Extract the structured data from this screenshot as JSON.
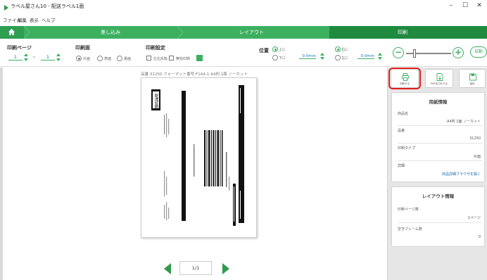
{
  "window": {
    "title": "ラベル屋さん10 - 配送ラベル1面",
    "minimize_glyph": "–",
    "maximize_glyph": "☐",
    "close_glyph": "✕"
  },
  "menu": [
    "ファイル",
    "編集",
    "表示",
    "ヘルプ"
  ],
  "steps": {
    "step1": "差し込み",
    "step2": "レイアウト",
    "step3": "印刷"
  },
  "toolbar": {
    "print_pages": {
      "title": "印刷ページ",
      "from": "1",
      "tilde": "~",
      "to": "1"
    },
    "print_side": {
      "title": "印刷面",
      "options": [
        "片面",
        "表面",
        "裏面"
      ],
      "selected": "片面"
    },
    "print_settings": {
      "title": "印刷設定",
      "opt1": "左右反転",
      "opt2": "無効印刷"
    },
    "position": {
      "title": "位置",
      "up": "上に",
      "down": "下に",
      "left": "左に",
      "right": "右に",
      "vertical_value": "0.0mm",
      "horizontal_value": "0.0mm"
    },
    "zoom": {
      "minus": "−",
      "plus": "+",
      "auto": "自動"
    }
  },
  "preview": {
    "caption": "品番:31250 フォーマット番号:F1A4-1 A4判 1面 ノーカット",
    "label_stamp": "配達証明",
    "page_indicator": "1/1"
  },
  "actions": {
    "print": "印刷する",
    "pdf": "PDF出力をする",
    "save": "保存"
  },
  "paper_info": {
    "title": "用紙情報",
    "product_name_label": "商品名",
    "product_name": "A4判 1面 ノーカット",
    "product_no_label": "品番",
    "product_no": "31250",
    "print_type_label": "印刷タイプ",
    "print_type": "片面",
    "details_label": "詳細",
    "details_link": "商品詳細ブラウザを開く"
  },
  "layout_info": {
    "title": "レイアウト情報",
    "pages_label": "印刷ページ数",
    "pages": "1ページ",
    "empty_frames_label": "空きフレーム数",
    "empty_frames": "0"
  },
  "colors": {
    "brand_green": "#3db060",
    "dark_green": "#208a3f",
    "highlight_red": "#e01e1e",
    "link_blue": "#1a6fb0"
  }
}
